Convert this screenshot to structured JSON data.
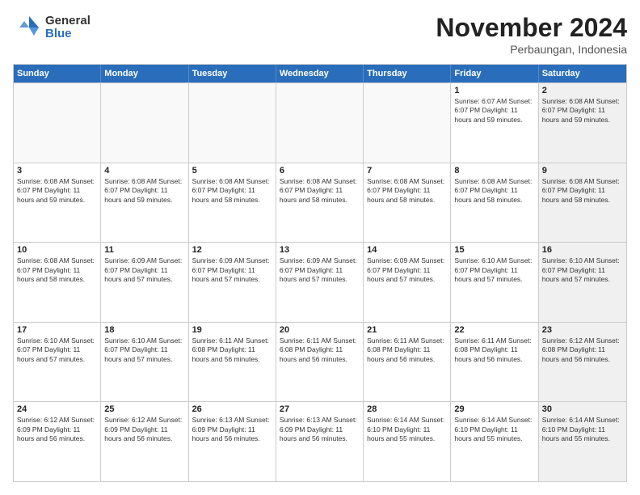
{
  "logo": {
    "general": "General",
    "blue": "Blue"
  },
  "title": "November 2024",
  "subtitle": "Perbaungan, Indonesia",
  "weekdays": [
    "Sunday",
    "Monday",
    "Tuesday",
    "Wednesday",
    "Thursday",
    "Friday",
    "Saturday"
  ],
  "rows": [
    [
      {
        "day": "",
        "info": "",
        "empty": true
      },
      {
        "day": "",
        "info": "",
        "empty": true
      },
      {
        "day": "",
        "info": "",
        "empty": true
      },
      {
        "day": "",
        "info": "",
        "empty": true
      },
      {
        "day": "",
        "info": "",
        "empty": true
      },
      {
        "day": "1",
        "info": "Sunrise: 6:07 AM\nSunset: 6:07 PM\nDaylight: 11 hours and 59 minutes.",
        "empty": false
      },
      {
        "day": "2",
        "info": "Sunrise: 6:08 AM\nSunset: 6:07 PM\nDaylight: 11 hours and 59 minutes.",
        "empty": false,
        "shaded": true
      }
    ],
    [
      {
        "day": "3",
        "info": "Sunrise: 6:08 AM\nSunset: 6:07 PM\nDaylight: 11 hours and 59 minutes.",
        "empty": false
      },
      {
        "day": "4",
        "info": "Sunrise: 6:08 AM\nSunset: 6:07 PM\nDaylight: 11 hours and 59 minutes.",
        "empty": false
      },
      {
        "day": "5",
        "info": "Sunrise: 6:08 AM\nSunset: 6:07 PM\nDaylight: 11 hours and 58 minutes.",
        "empty": false
      },
      {
        "day": "6",
        "info": "Sunrise: 6:08 AM\nSunset: 6:07 PM\nDaylight: 11 hours and 58 minutes.",
        "empty": false
      },
      {
        "day": "7",
        "info": "Sunrise: 6:08 AM\nSunset: 6:07 PM\nDaylight: 11 hours and 58 minutes.",
        "empty": false
      },
      {
        "day": "8",
        "info": "Sunrise: 6:08 AM\nSunset: 6:07 PM\nDaylight: 11 hours and 58 minutes.",
        "empty": false
      },
      {
        "day": "9",
        "info": "Sunrise: 6:08 AM\nSunset: 6:07 PM\nDaylight: 11 hours and 58 minutes.",
        "empty": false,
        "shaded": true
      }
    ],
    [
      {
        "day": "10",
        "info": "Sunrise: 6:08 AM\nSunset: 6:07 PM\nDaylight: 11 hours and 58 minutes.",
        "empty": false
      },
      {
        "day": "11",
        "info": "Sunrise: 6:09 AM\nSunset: 6:07 PM\nDaylight: 11 hours and 57 minutes.",
        "empty": false
      },
      {
        "day": "12",
        "info": "Sunrise: 6:09 AM\nSunset: 6:07 PM\nDaylight: 11 hours and 57 minutes.",
        "empty": false
      },
      {
        "day": "13",
        "info": "Sunrise: 6:09 AM\nSunset: 6:07 PM\nDaylight: 11 hours and 57 minutes.",
        "empty": false
      },
      {
        "day": "14",
        "info": "Sunrise: 6:09 AM\nSunset: 6:07 PM\nDaylight: 11 hours and 57 minutes.",
        "empty": false
      },
      {
        "day": "15",
        "info": "Sunrise: 6:10 AM\nSunset: 6:07 PM\nDaylight: 11 hours and 57 minutes.",
        "empty": false
      },
      {
        "day": "16",
        "info": "Sunrise: 6:10 AM\nSunset: 6:07 PM\nDaylight: 11 hours and 57 minutes.",
        "empty": false,
        "shaded": true
      }
    ],
    [
      {
        "day": "17",
        "info": "Sunrise: 6:10 AM\nSunset: 6:07 PM\nDaylight: 11 hours and 57 minutes.",
        "empty": false
      },
      {
        "day": "18",
        "info": "Sunrise: 6:10 AM\nSunset: 6:07 PM\nDaylight: 11 hours and 57 minutes.",
        "empty": false
      },
      {
        "day": "19",
        "info": "Sunrise: 6:11 AM\nSunset: 6:08 PM\nDaylight: 11 hours and 56 minutes.",
        "empty": false
      },
      {
        "day": "20",
        "info": "Sunrise: 6:11 AM\nSunset: 6:08 PM\nDaylight: 11 hours and 56 minutes.",
        "empty": false
      },
      {
        "day": "21",
        "info": "Sunrise: 6:11 AM\nSunset: 6:08 PM\nDaylight: 11 hours and 56 minutes.",
        "empty": false
      },
      {
        "day": "22",
        "info": "Sunrise: 6:11 AM\nSunset: 6:08 PM\nDaylight: 11 hours and 56 minutes.",
        "empty": false
      },
      {
        "day": "23",
        "info": "Sunrise: 6:12 AM\nSunset: 6:08 PM\nDaylight: 11 hours and 56 minutes.",
        "empty": false,
        "shaded": true
      }
    ],
    [
      {
        "day": "24",
        "info": "Sunrise: 6:12 AM\nSunset: 6:09 PM\nDaylight: 11 hours and 56 minutes.",
        "empty": false
      },
      {
        "day": "25",
        "info": "Sunrise: 6:12 AM\nSunset: 6:09 PM\nDaylight: 11 hours and 56 minutes.",
        "empty": false
      },
      {
        "day": "26",
        "info": "Sunrise: 6:13 AM\nSunset: 6:09 PM\nDaylight: 11 hours and 56 minutes.",
        "empty": false
      },
      {
        "day": "27",
        "info": "Sunrise: 6:13 AM\nSunset: 6:09 PM\nDaylight: 11 hours and 56 minutes.",
        "empty": false
      },
      {
        "day": "28",
        "info": "Sunrise: 6:14 AM\nSunset: 6:10 PM\nDaylight: 11 hours and 55 minutes.",
        "empty": false
      },
      {
        "day": "29",
        "info": "Sunrise: 6:14 AM\nSunset: 6:10 PM\nDaylight: 11 hours and 55 minutes.",
        "empty": false
      },
      {
        "day": "30",
        "info": "Sunrise: 6:14 AM\nSunset: 6:10 PM\nDaylight: 11 hours and 55 minutes.",
        "empty": false,
        "shaded": true
      }
    ]
  ]
}
